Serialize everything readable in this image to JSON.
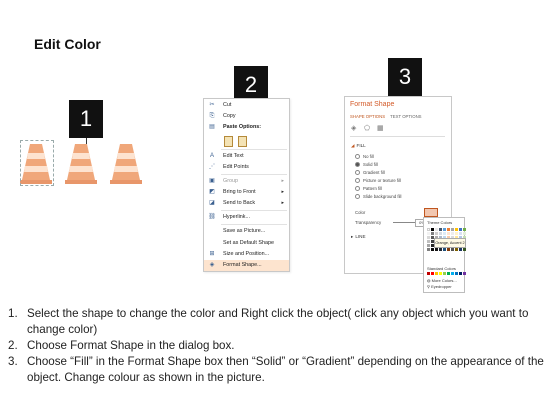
{
  "heading": "Edit Color",
  "badges": [
    "1",
    "2",
    "3"
  ],
  "context_menu": {
    "items": [
      {
        "icon": "scissors-icon",
        "glyph": "✂",
        "label": "Cut"
      },
      {
        "icon": "copy-icon",
        "glyph": "⎘",
        "label": "Copy"
      },
      {
        "icon": "paste-icon",
        "glyph": "▤",
        "label": "Paste Options:"
      },
      {
        "icon": "edit-text-icon",
        "glyph": "A",
        "label": "Edit Text"
      },
      {
        "icon": "edit-points-icon",
        "glyph": "⋰",
        "label": "Edit Points"
      },
      {
        "icon": "group-icon",
        "glyph": "▣",
        "label": "Group",
        "submenu": true
      },
      {
        "icon": "bring-front-icon",
        "glyph": "◩",
        "label": "Bring to Front",
        "submenu": true
      },
      {
        "icon": "send-back-icon",
        "glyph": "◪",
        "label": "Send to Back",
        "submenu": true
      },
      {
        "icon": "hyperlink-icon",
        "glyph": "⛓",
        "label": "Hyperlink..."
      },
      {
        "icon": "",
        "glyph": "",
        "label": "Save as Picture..."
      },
      {
        "icon": "",
        "glyph": "",
        "label": "Set as Default Shape"
      },
      {
        "icon": "size-position-icon",
        "glyph": "⊞",
        "label": "Size and Position..."
      },
      {
        "icon": "format-shape-icon",
        "glyph": "◈",
        "label": "Format Shape..."
      }
    ]
  },
  "format_pane": {
    "title": "Format Shape",
    "tabs": [
      "SHAPE OPTIONS",
      "TEXT OPTIONS"
    ],
    "fill_header": "FILL",
    "fill_options": [
      "No fill",
      "Solid fill",
      "Gradient fill",
      "Picture or texture fill",
      "Pattern fill",
      "Slide background fill"
    ],
    "selected_fill": "Solid fill",
    "color_label": "Color",
    "transparency_label": "Transparency",
    "transparency_value": "0%",
    "line_header": "LINE"
  },
  "color_dropdown": {
    "theme_label": "Theme Colors",
    "tooltip": "Orange, Accent 2",
    "standard_label": "Standard Colors",
    "more_colors": "More Colors...",
    "eyedropper": "Eyedropper"
  },
  "steps": [
    {
      "num": "1.",
      "text": "Select the shape to change the color and Right click the object( click any object which you want to change color)"
    },
    {
      "num": "2.",
      "text": "Choose Format Shape in the dialog box."
    },
    {
      "num": "3.",
      "text": "Choose “Fill” in the Format Shape box then “Solid” or “Gradient” depending on the appearance of the object. Change colour as shown in the picture."
    }
  ],
  "colors": {
    "cone_orange": "#f0a77a",
    "cone_stripe": "#fde3d0",
    "accent": "#c0561f"
  }
}
